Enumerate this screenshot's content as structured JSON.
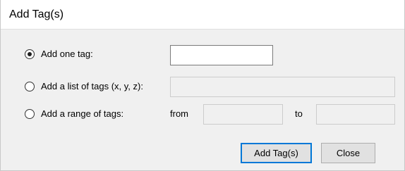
{
  "dialog": {
    "title": "Add Tag(s)"
  },
  "options": {
    "add_one_tag": {
      "label": "Add one tag:",
      "selected": true,
      "value": ""
    },
    "add_list_tags": {
      "label": "Add a list of tags (x, y, z):",
      "selected": false,
      "value": ""
    },
    "add_range_tags": {
      "label": "Add a range of tags:",
      "selected": false,
      "from_label": "from",
      "to_label": "to",
      "from_value": "",
      "to_value": ""
    }
  },
  "buttons": {
    "add_tags": "Add Tag(s)",
    "close": "Close"
  }
}
